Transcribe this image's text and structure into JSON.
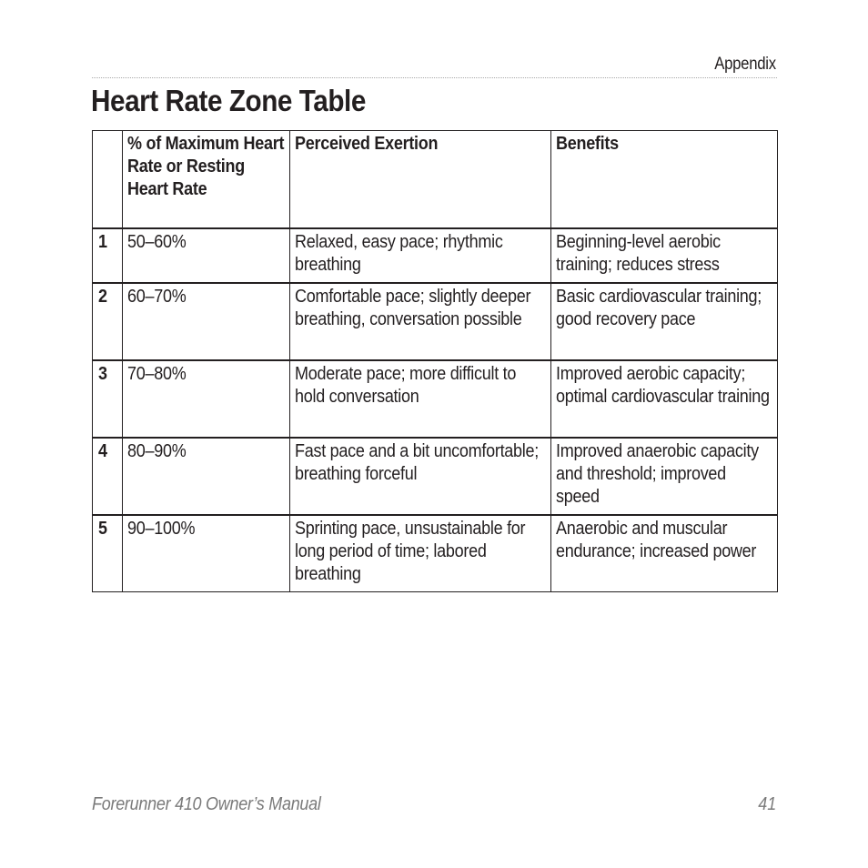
{
  "header": {
    "section": "Appendix",
    "title": "Heart Rate Zone Table"
  },
  "table": {
    "columns": [
      "",
      "% of Maximum Heart Rate or Resting Heart Rate",
      "Perceived Exertion",
      "Benefits"
    ],
    "rows": [
      {
        "zone": "1",
        "percent": "50–60%",
        "exertion": "Relaxed, easy pace; rhythmic breathing",
        "benefits": "Beginning-level aerobic training; reduces stress"
      },
      {
        "zone": "2",
        "percent": "60–70%",
        "exertion": "Comfortable pace; slightly deeper breathing, conversation possible",
        "benefits": "Basic cardiovascular training; good recovery pace"
      },
      {
        "zone": "3",
        "percent": "70–80%",
        "exertion": "Moderate pace; more difficult to hold conversation",
        "benefits": "Improved aerobic capacity; optimal cardiovascular training"
      },
      {
        "zone": "4",
        "percent": "80–90%",
        "exertion": "Fast pace and a bit uncomfortable; breathing forceful",
        "benefits": "Improved anaerobic capacity and threshold; improved speed"
      },
      {
        "zone": "5",
        "percent": "90–100%",
        "exertion": "Sprinting pace, unsustainable for long period of time; labored breathing",
        "benefits": "Anaerobic and muscular endurance; increased power"
      }
    ]
  },
  "footer": {
    "manual_title": "Forerunner 410 Owner’s Manual",
    "page_number": "41"
  }
}
